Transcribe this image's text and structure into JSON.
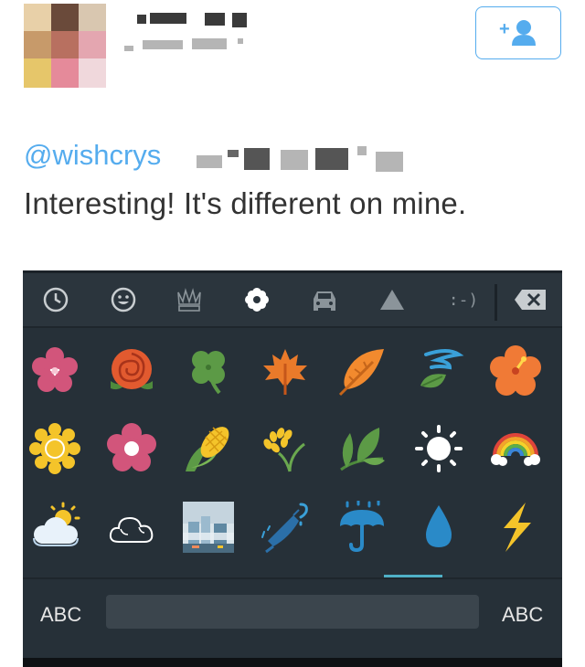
{
  "tweet": {
    "reply_handle": "@wishcrys",
    "text": "Interesting! It's different on mine."
  },
  "follow_button": {
    "icon": "add-user-icon",
    "color": "#55acee"
  },
  "keyboard": {
    "categories": [
      "recent-icon",
      "smiley-icon",
      "crown-icon",
      "flower-icon",
      "car-icon",
      "triangle-icon",
      "emoticon-text-icon"
    ],
    "emoticon_label": ":-)",
    "emoji_rows": [
      [
        "cherry-blossom",
        "rose",
        "four-leaf-clover",
        "maple-leaf",
        "fallen-leaf",
        "leaf-in-wind",
        "hibiscus"
      ],
      [
        "sunflower",
        "blossom",
        "corn",
        "rice-plant",
        "herb",
        "sun",
        "rainbow"
      ],
      [
        "sun-behind-cloud",
        "cloud",
        "foggy-city",
        "closed-umbrella",
        "umbrella-with-rain",
        "droplet",
        "lightning"
      ]
    ],
    "left_key": "ABC",
    "right_key": "ABC",
    "accent": "#4fb0c6"
  }
}
